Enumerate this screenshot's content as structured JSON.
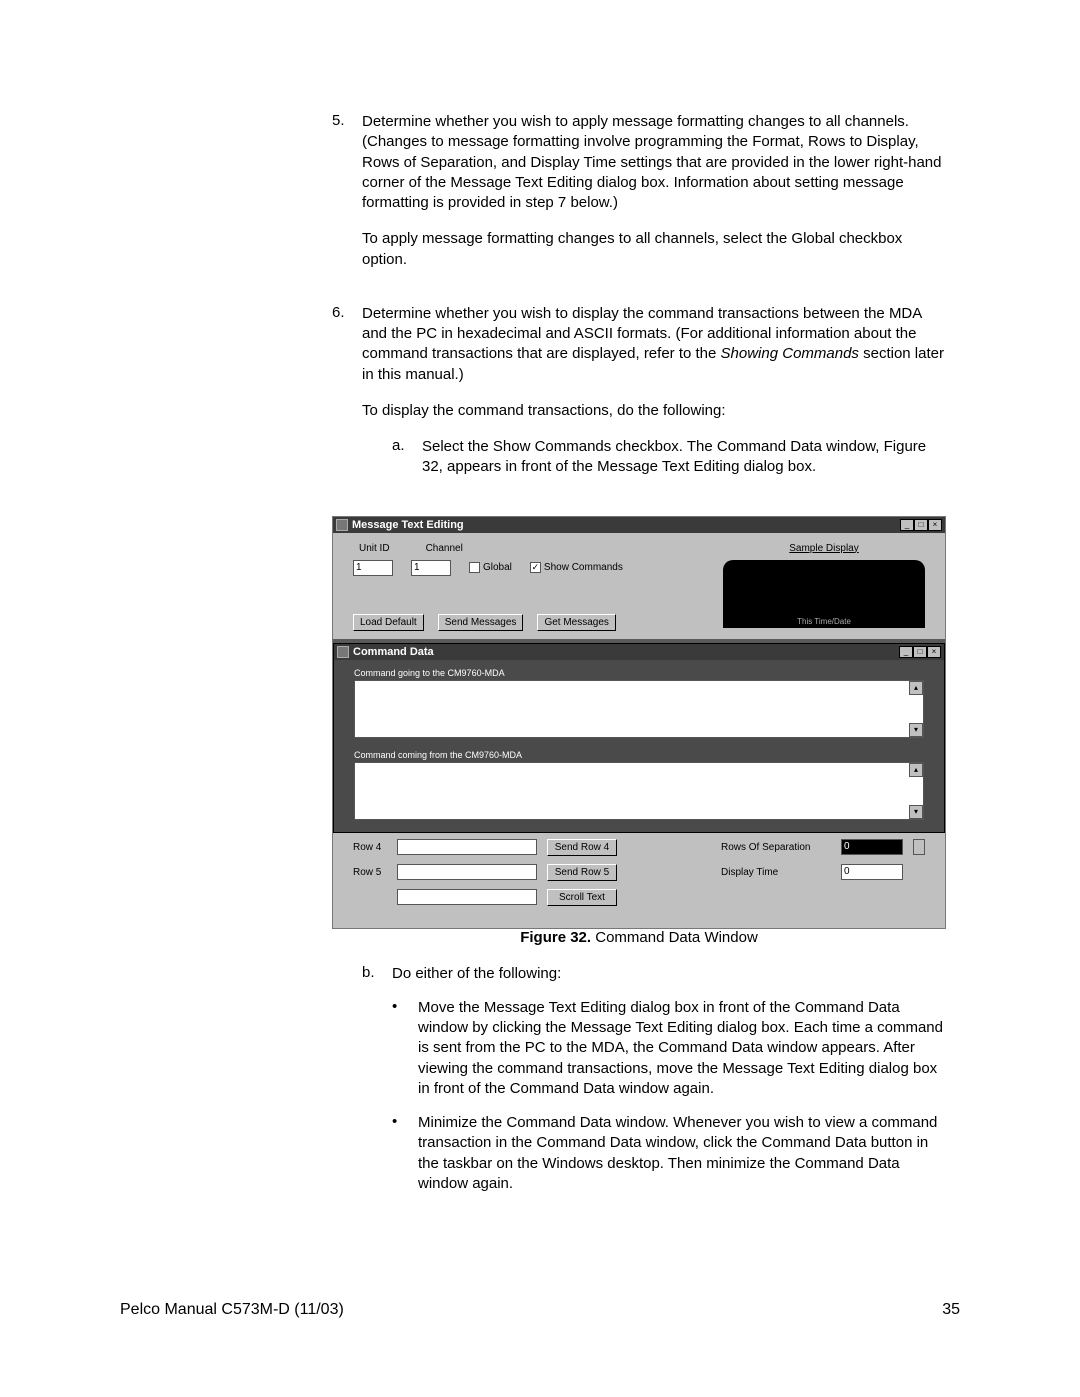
{
  "list": {
    "item5": {
      "num": "5.",
      "p1": "Determine whether you wish to apply message formatting changes to all channels. (Changes to message formatting involve programming the Format, Rows to Display, Rows of Separation, and Display Time settings that are provided in the lower right-hand corner of the Message Text Editing dialog box. Information about setting message formatting is provided in step 7 below.)",
      "p2": "To apply message formatting changes to all channels, select the Global checkbox option."
    },
    "item6": {
      "num": "6.",
      "p1_a": "Determine whether you wish to display the command transactions between the MDA and the PC in hexadecimal and ASCII formats. (For additional information about the command transactions that are displayed, refer to the ",
      "p1_i": "Showing Commands",
      "p1_b": " section later in this manual.)",
      "p2": "To display the command transactions, do the following:",
      "sub_a": {
        "letter": "a.",
        "text": "Select the Show Commands checkbox. The Command Data window, Figure 32, appears in front of the Message Text Editing dialog box."
      },
      "sub_b": {
        "letter": "b.",
        "text": "Do either of the following:",
        "bullet1": "Move the Message Text Editing dialog box in front of the Command Data window by clicking the Message Text Editing dialog box. Each time a command is sent from the PC to the MDA, the Command Data window appears. After viewing the command transactions, move the Message Text Editing dialog box in front of the Command Data window again.",
        "bullet2": "Minimize the Command Data window. Whenever you wish to view a command transaction in the Command Data window, click the Command Data button in the taskbar on the Windows desktop. Then minimize the Command Data window again."
      }
    }
  },
  "figure": {
    "label": "Figure 32.",
    "caption": "  Command Data Window"
  },
  "dlg": {
    "title": "Message Text Editing",
    "unit_id_label": "Unit ID",
    "channel_label": "Channel",
    "unit_id_value": "1",
    "channel_value": "1",
    "global_label": "Global",
    "show_cmds_label": "Show Commands",
    "load_default": "Load Default",
    "send_messages": "Send Messages",
    "get_messages": "Get Messages",
    "sample_display": "Sample Display",
    "sample_tiny": "This Time/Date",
    "inner_title": "Command Data",
    "going_label": "Command going to the CM9760-MDA",
    "coming_label": "Command coming from the CM9760-MDA",
    "row4": "Row 4",
    "row5": "Row 5",
    "send_row4": "Send Row 4",
    "send_row5": "Send Row 5",
    "scroll_text": "Scroll Text",
    "rows_sep_label": "Rows Of Separation",
    "rows_sep_value": "0",
    "display_time_label": "Display Time",
    "display_time_value": "0"
  },
  "footer": {
    "left": "Pelco Manual C573M-D (11/03)",
    "right": "35"
  }
}
